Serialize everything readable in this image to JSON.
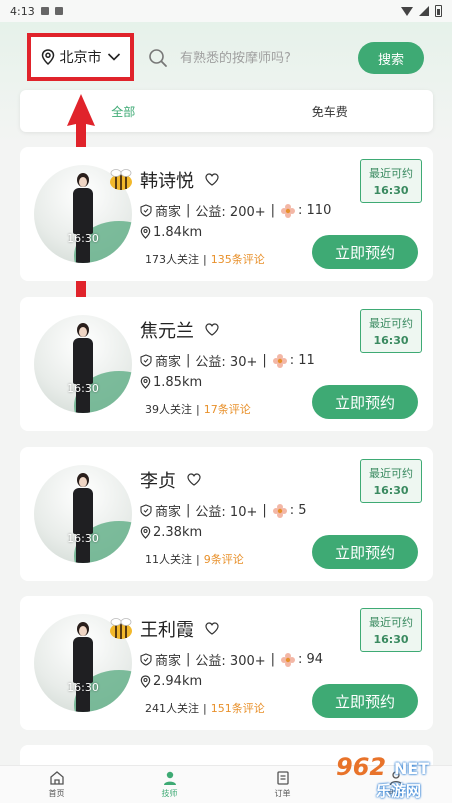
{
  "status_bar": {
    "time": "4:13"
  },
  "header": {
    "city": "北京市",
    "search_placeholder": "有熟悉的按摩师吗?",
    "search_button": "搜索"
  },
  "tabs": [
    {
      "label": "全部",
      "active": true
    },
    {
      "label": "免车费",
      "active": false
    }
  ],
  "therapists": [
    {
      "name": "韩诗悦",
      "badge": "bee",
      "type": "商家",
      "welfare": "公益: 200+",
      "flowers": ": 110",
      "distance": "1.84km",
      "followers": "173人关注",
      "comments": "135条评论",
      "recent_label": "最近可约",
      "recent_time": "16:30",
      "avatar_time": "16:30",
      "book": "立即预约"
    },
    {
      "name": "焦元兰",
      "badge": "",
      "type": "商家",
      "welfare": "公益: 30+",
      "flowers": ": 11",
      "distance": "1.85km",
      "followers": "39人关注",
      "comments": "17条评论",
      "recent_label": "最近可约",
      "recent_time": "16:30",
      "avatar_time": "16:30",
      "book": "立即预约"
    },
    {
      "name": "李贞",
      "badge": "",
      "type": "商家",
      "welfare": "公益: 10+",
      "flowers": ": 5",
      "distance": "2.38km",
      "followers": "11人关注",
      "comments": "9条评论",
      "recent_label": "最近可约",
      "recent_time": "16:30",
      "avatar_time": "16:30",
      "book": "立即预约"
    },
    {
      "name": "王利霞",
      "badge": "bee",
      "type": "商家",
      "welfare": "公益: 300+",
      "flowers": ": 94",
      "distance": "2.94km",
      "followers": "241人关注",
      "comments": "151条评论",
      "recent_label": "最近可约",
      "recent_time": "16:30",
      "avatar_time": "16:30",
      "book": "立即预约"
    }
  ],
  "bottom_nav": [
    {
      "label": "首页",
      "icon": "home-icon"
    },
    {
      "label": "技师",
      "icon": "therapist-icon",
      "active": true
    },
    {
      "label": "订单",
      "icon": "orders-icon"
    },
    {
      "label": "我的",
      "icon": "profile-icon"
    }
  ],
  "watermark": {
    "line1": "962",
    "line2": "NET",
    "line3": "乐游网"
  },
  "colors": {
    "accent": "#3eaa74",
    "highlight": "#e0232b",
    "comment": "#e8902a"
  }
}
